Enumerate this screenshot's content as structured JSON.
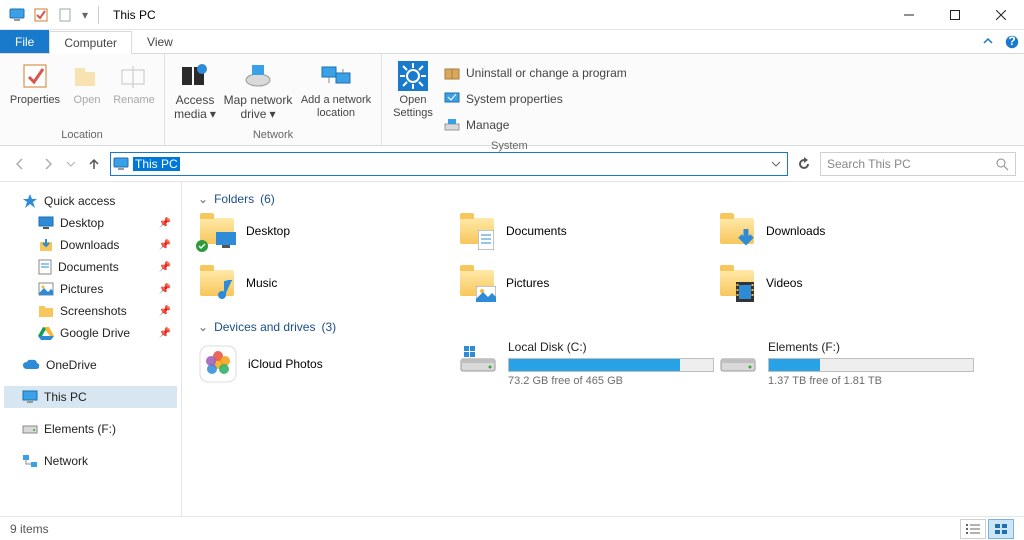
{
  "title": "This PC",
  "tabs": {
    "file": "File",
    "computer": "Computer",
    "view": "View"
  },
  "ribbon": {
    "location": {
      "label": "Location",
      "properties": "Properties",
      "open": "Open",
      "rename": "Rename"
    },
    "network": {
      "label": "Network",
      "access": "Access media",
      "mapdrive": "Map network drive",
      "addloc": "Add a network location"
    },
    "system": {
      "label": "System",
      "opensettings": "Open Settings",
      "uninstall": "Uninstall or change a program",
      "sysprops": "System properties",
      "manage": "Manage"
    }
  },
  "address": "This PC",
  "search_placeholder": "Search This PC",
  "tree": {
    "quick": "Quick access",
    "desktop": "Desktop",
    "downloads": "Downloads",
    "documents": "Documents",
    "pictures": "Pictures",
    "screenshots": "Screenshots",
    "gdrive": "Google Drive",
    "onedrive": "OneDrive",
    "thispc": "This PC",
    "elements": "Elements (F:)",
    "network": "Network"
  },
  "sections": {
    "folders": {
      "title": "Folders",
      "count": "(6)"
    },
    "drives": {
      "title": "Devices and drives",
      "count": "(3)"
    }
  },
  "folders": {
    "desktop": "Desktop",
    "documents": "Documents",
    "downloads": "Downloads",
    "music": "Music",
    "pictures": "Pictures",
    "videos": "Videos"
  },
  "drives": {
    "icloud": {
      "name": "iCloud Photos"
    },
    "c": {
      "name": "Local Disk (C:)",
      "free": "73.2 GB free of 465 GB",
      "fill": 84
    },
    "f": {
      "name": "Elements (F:)",
      "free": "1.37 TB free of 1.81 TB",
      "fill": 25
    }
  },
  "status": "9 items"
}
